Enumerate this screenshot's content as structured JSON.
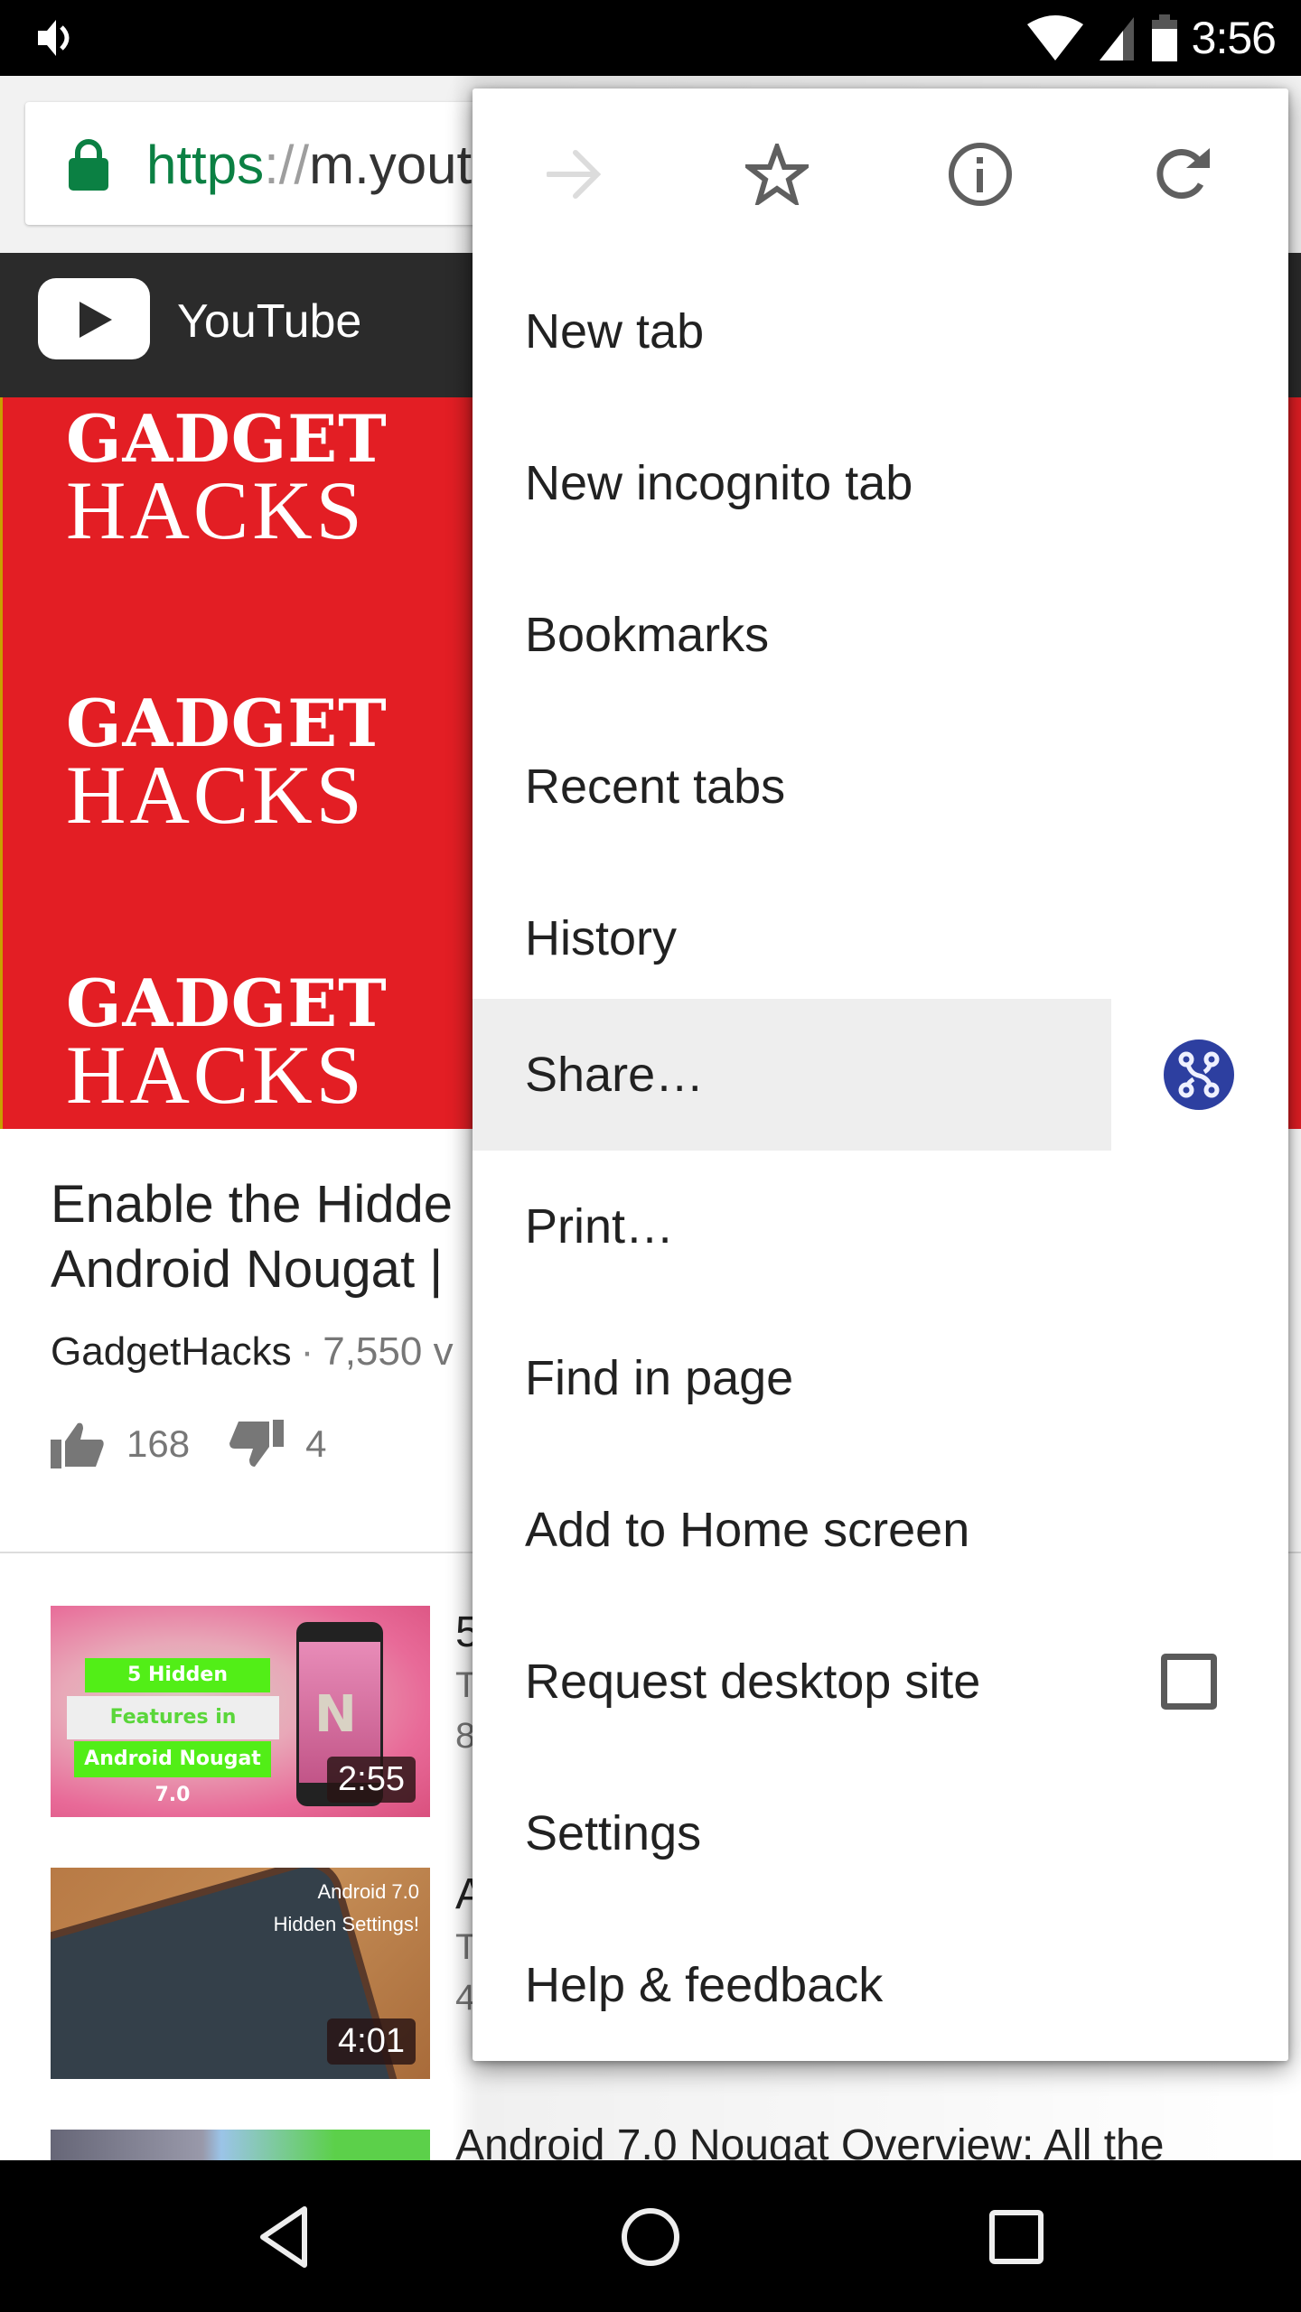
{
  "status_bar": {
    "time": "3:56",
    "icons": [
      "volume-icon",
      "wifi-icon",
      "cell-signal-icon",
      "battery-icon"
    ]
  },
  "browser": {
    "url_scheme": "https",
    "url_separator": "://",
    "url_host": "m.youtu",
    "lock_color": "#0b8043"
  },
  "site_header": {
    "title": "YouTube"
  },
  "banner": {
    "blocks": [
      {
        "line1": "GADGET",
        "line2": "HACKS"
      },
      {
        "line1": "GADGET",
        "line2": "HACKS"
      },
      {
        "line1": "GADGET",
        "line2": "HACKS"
      }
    ],
    "color": "#e31e24"
  },
  "video": {
    "title_line1": "Enable the Hidde",
    "title_line2": "Android Nougat |",
    "channel": "GadgetHacks",
    "separator": "·",
    "views": "7,550 v",
    "likes": "168",
    "dislikes": "4"
  },
  "related": [
    {
      "title": "5",
      "line2": "T",
      "line3": "8",
      "duration": "2:55",
      "thumb_text": [
        "5 Hidden",
        "Features in",
        "Android Nougat 7.0"
      ],
      "thumb_logo": "N"
    },
    {
      "title": "A",
      "line2": "T",
      "line3": "4",
      "duration": "4:01",
      "thumb_text": [
        "Android 7.0",
        "Hidden Settings!"
      ]
    },
    {
      "title": "Android 7.0 Nougat Overview: All the"
    }
  ],
  "menu": {
    "icons": [
      {
        "name": "forward-icon",
        "enabled": false
      },
      {
        "name": "bookmark-star-icon",
        "enabled": true
      },
      {
        "name": "page-info-icon",
        "enabled": true
      },
      {
        "name": "reload-icon",
        "enabled": true
      }
    ],
    "items": [
      {
        "label": "New tab"
      },
      {
        "label": "New incognito tab"
      },
      {
        "label": "Bookmarks"
      },
      {
        "label": "Recent tabs"
      },
      {
        "label": "History"
      },
      {
        "label": "Share…",
        "highlighted": true,
        "app_icon": "share-app-icon",
        "app_icon_color": "#2d3fa0"
      },
      {
        "label": "Print…"
      },
      {
        "label": "Find in page"
      },
      {
        "label": "Add to Home screen"
      },
      {
        "label": "Request desktop site",
        "checkbox": true,
        "checked": false
      },
      {
        "label": "Settings"
      },
      {
        "label": "Help & feedback"
      }
    ]
  },
  "nav_bar": {
    "buttons": [
      "back-icon",
      "home-icon",
      "recents-icon"
    ]
  }
}
